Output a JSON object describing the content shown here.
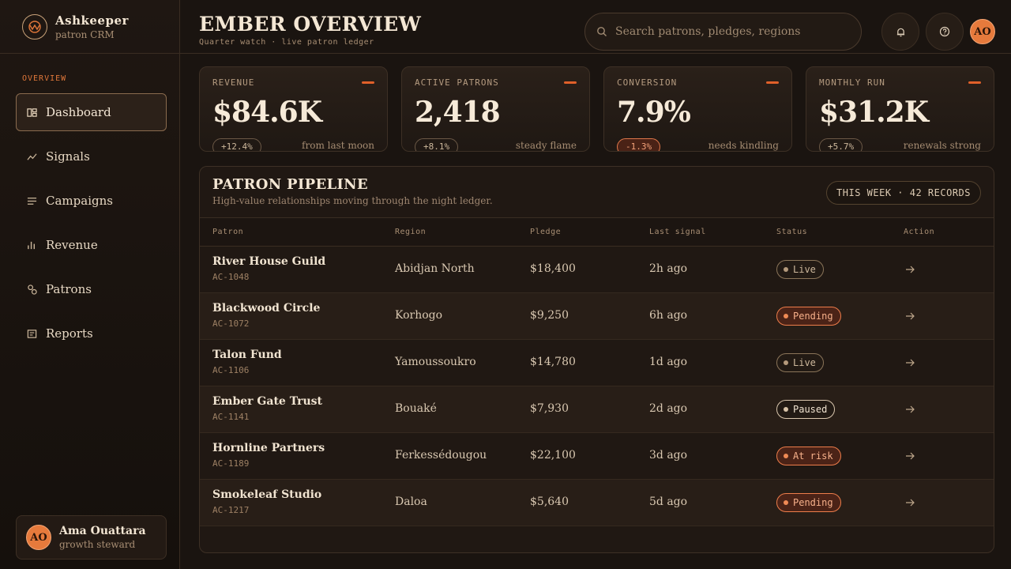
{
  "brand": {
    "name": "Ashkeeper",
    "subtitle": "patron CRM"
  },
  "sidebar": {
    "section_label": "OVERVIEW",
    "items": [
      {
        "label": "Dashboard",
        "icon": "dashboard-icon",
        "active": true
      },
      {
        "label": "Signals",
        "icon": "signals-icon"
      },
      {
        "label": "Campaigns",
        "icon": "campaigns-icon"
      },
      {
        "label": "Revenue",
        "icon": "revenue-icon"
      },
      {
        "label": "Patrons",
        "icon": "patrons-icon"
      },
      {
        "label": "Reports",
        "icon": "reports-icon"
      }
    ],
    "user": {
      "initials": "AO",
      "name": "Ama Ouattara",
      "role": "growth steward"
    }
  },
  "header": {
    "title": "EMBER OVERVIEW",
    "subtitle": "Quarter watch · live patron ledger",
    "search_placeholder": "Search patrons, pledges, regions",
    "avatar_initials": "AO"
  },
  "kpis": [
    {
      "label": "REVENUE",
      "value": "$84.6K",
      "delta": "+12.4%",
      "note": "from last moon",
      "negative": false
    },
    {
      "label": "ACTIVE PATRONS",
      "value": "2,418",
      "delta": "+8.1%",
      "note": "steady flame",
      "negative": false
    },
    {
      "label": "CONVERSION",
      "value": "7.9%",
      "delta": "-1.3%",
      "note": "needs kindling",
      "negative": true
    },
    {
      "label": "MONTHLY RUN",
      "value": "$31.2K",
      "delta": "+5.7%",
      "note": "renewals strong",
      "negative": false
    }
  ],
  "pipeline": {
    "title": "PATRON PIPELINE",
    "subtitle": "High-value relationships moving through the night ledger.",
    "chip": "THIS WEEK · 42 RECORDS",
    "columns": [
      "Patron",
      "Region",
      "Pledge",
      "Last signal",
      "Status",
      "Action"
    ],
    "rows": [
      {
        "name": "River House Guild",
        "id": "AC-1048",
        "region": "Abidjan North",
        "pledge": "$18,400",
        "last": "2h ago",
        "status": "Live",
        "kind": "live"
      },
      {
        "name": "Blackwood Circle",
        "id": "AC-1072",
        "region": "Korhogo",
        "pledge": "$9,250",
        "last": "6h ago",
        "status": "Pending",
        "kind": "pending"
      },
      {
        "name": "Talon Fund",
        "id": "AC-1106",
        "region": "Yamoussoukro",
        "pledge": "$14,780",
        "last": "1d ago",
        "status": "Live",
        "kind": "live"
      },
      {
        "name": "Ember Gate Trust",
        "id": "AC-1141",
        "region": "Bouaké",
        "pledge": "$7,930",
        "last": "2d ago",
        "status": "Paused",
        "kind": "paused"
      },
      {
        "name": "Hornline Partners",
        "id": "AC-1189",
        "region": "Ferkessédougou",
        "pledge": "$22,100",
        "last": "3d ago",
        "status": "At risk",
        "kind": "risk"
      },
      {
        "name": "Smokeleaf Studio",
        "id": "AC-1217",
        "region": "Daloa",
        "pledge": "$5,640",
        "last": "5d ago",
        "status": "Pending",
        "kind": "pending"
      }
    ]
  },
  "colors": {
    "accent": "#e0602a",
    "background": "#1a1410",
    "avatar": "#e67a3c"
  }
}
